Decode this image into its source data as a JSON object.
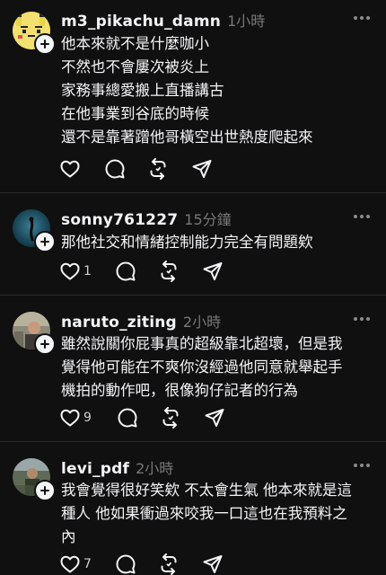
{
  "posts": [
    {
      "username": "m3_pikachu_damn",
      "timestamp": "1小時",
      "avatar_icon": "pikachu-avatar",
      "lines": [
        "他本來就不是什麼咖小",
        "不然也不會屢次被炎上",
        "家務事總愛搬上直播講古",
        "在他事業到谷底的時候",
        "還不是靠著蹭他哥橫空出世熱度爬起來"
      ],
      "like_count": "",
      "actions": [
        "heart-icon",
        "comment-icon",
        "repost-icon",
        "share-icon"
      ]
    },
    {
      "username": "sonny761227",
      "timestamp": "15分鐘",
      "avatar_icon": "diver-avatar",
      "lines": [
        "那他社交和情緒控制能力完全有問題欸"
      ],
      "like_count": "1",
      "actions": [
        "heart-icon",
        "comment-icon",
        "repost-icon",
        "share-icon"
      ]
    },
    {
      "username": "naruto_ziting",
      "timestamp": "2小時",
      "avatar_icon": "photo-avatar",
      "lines": [
        "雖然說關你屁事真的超級靠北超壞，但是我",
        "覺得他可能在不爽你沒經過他同意就舉起手",
        "機拍的動作吧，很像狗仔記者的行為"
      ],
      "like_count": "9",
      "actions": [
        "heart-icon",
        "comment-icon",
        "repost-icon",
        "share-icon"
      ]
    },
    {
      "username": "levi_pdf",
      "timestamp": "2小時",
      "avatar_icon": "outdoor-avatar",
      "lines": [
        "我會覺得很好笑欸 不太會生氣 他本來就是這",
        "種人 他如果衝過來咬我一口這也在我預料之",
        "內"
      ],
      "like_count": "7",
      "actions": [
        "heart-icon",
        "comment-icon",
        "repost-icon",
        "share-icon"
      ]
    }
  ],
  "colors": {
    "background": "#101010",
    "text": "#f3f5f7",
    "muted": "#777777",
    "divider": "#2a2a2a"
  }
}
